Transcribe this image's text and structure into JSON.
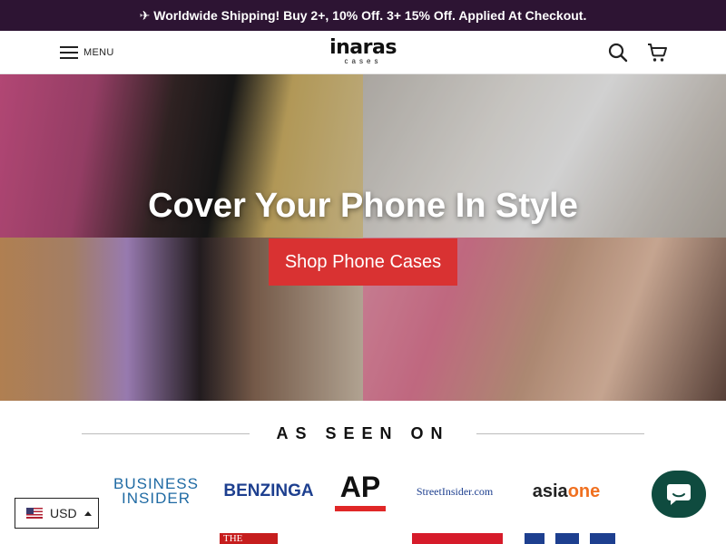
{
  "announcement": "✈ Worldwide Shipping! Buy 2+, 10% Off. 3+ 15% Off. Applied At Checkout.",
  "header": {
    "menu_label": "MENU",
    "logo_main": "inaras",
    "logo_sub": "cases",
    "search_icon": "search-icon",
    "cart_icon": "cart-icon"
  },
  "hero": {
    "title": "Cover Your Phone In Style",
    "cta_label": "Shop Phone Cases"
  },
  "press": {
    "heading": "AS SEEN ON",
    "logos": {
      "business_insider_line1": "BUSINESS",
      "business_insider_line2": "INSIDER",
      "benzinga": "BENZINGA",
      "ap": "AP",
      "streetinsider": "StreetInsider.com",
      "asiaone_a": "asia",
      "asiaone_b": "one",
      "partial_1": "THE"
    }
  },
  "currency": {
    "code": "USD",
    "flag_icon": "us-flag-icon"
  },
  "chat": {
    "icon": "chat-icon"
  },
  "colors": {
    "announcement_bg": "#2d1433",
    "cta_bg": "#d93232",
    "chat_bg": "#0f4b3f"
  }
}
